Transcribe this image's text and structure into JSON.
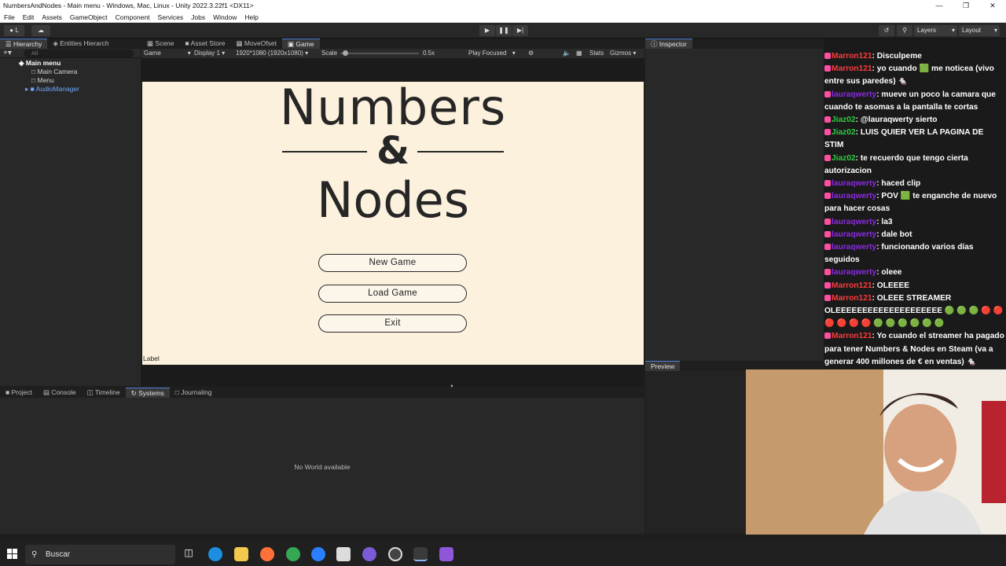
{
  "window": {
    "title": "NumbersAndNodes - Main menu - Windows, Mac, Linux - Unity 2022.3.22f1 <DX11>"
  },
  "menubar": [
    "File",
    "Edit",
    "Assets",
    "GameObject",
    "Component",
    "Services",
    "Jobs",
    "Window",
    "Help"
  ],
  "toolbar": {
    "account": "L",
    "layers": "Layers",
    "layout": "Layout"
  },
  "hierarchy": {
    "tabs": [
      "Hierarchy",
      "Entities Hierarch"
    ],
    "search_placeholder": "All",
    "items": [
      "Main menu",
      "Main Camera",
      "Menu",
      "AudioManager"
    ]
  },
  "game": {
    "tabs": [
      "Scene",
      "Asset Store",
      "MoveOfset",
      "Game"
    ],
    "display_mode": "Game",
    "display": "Display 1",
    "resolution": "1920*1080 (1920x1080)",
    "scale_label": "Scale",
    "scale_value": "0.5x",
    "play_mode": "Play Focused",
    "stats": "Stats",
    "gizmos": "Gizmos",
    "scale_fraction": 0.03
  },
  "menu_screen": {
    "title_line1": "Numbers",
    "title_amp": "&",
    "title_line2": "Nodes",
    "buttons": [
      "New Game",
      "Load Game",
      "Exit"
    ],
    "label": "Label"
  },
  "inspector": {
    "tab": "Inspector",
    "preview_tab": "Preview"
  },
  "bottom": {
    "tabs": [
      "Project",
      "Console",
      "Timeline",
      "Systems",
      "Journaling"
    ],
    "empty_message": "No World available"
  },
  "chat": [
    {
      "user": "Marron121",
      "color": "#ff3b3b",
      "text": "Disculpeme"
    },
    {
      "user": "Marron121",
      "color": "#ff3b3b",
      "text": "yo cuando 🟩 me noticea (vivo entre sus paredes) 🐁"
    },
    {
      "user": "lauraqwerty",
      "color": "#8a2be2",
      "text": "mueve un poco la camara que cuando te asomas a la pantalla te cortas"
    },
    {
      "user": "Jiaz02",
      "color": "#2ecc40",
      "text": "@lauraqwerty sierto"
    },
    {
      "user": "Jiaz02",
      "color": "#2ecc40",
      "text": "LUIS QUIER VER LA PAGINA DE STIM"
    },
    {
      "user": "Jiaz02",
      "color": "#2ecc40",
      "text": "te recuerdo que tengo cierta autorizacion"
    },
    {
      "user": "lauraqwerty",
      "color": "#8a2be2",
      "text": "haced clip"
    },
    {
      "user": "lauraqwerty",
      "color": "#8a2be2",
      "text": "POV 🟩 te enganche de nuevo para hacer cosas"
    },
    {
      "user": "lauraqwerty",
      "color": "#8a2be2",
      "text": "la3"
    },
    {
      "user": "lauraqwerty",
      "color": "#8a2be2",
      "text": "dale bot"
    },
    {
      "user": "lauraqwerty",
      "color": "#8a2be2",
      "text": "funcionando varios días seguidos"
    },
    {
      "user": "lauraqwerty",
      "color": "#8a2be2",
      "text": "oleee"
    },
    {
      "user": "Marron121",
      "color": "#ff3b3b",
      "text": "OLEEEE"
    },
    {
      "user": "Marron121",
      "color": "#ff3b3b",
      "text": "OLEEE STREAMER OLEEEEEEEEEEEEEEEEEEEE 🟢 🟢 🟢 🔴 🔴 🔴 🔴 🔴 🔴 🟢 🟢 🟢 🟢 🟢 🟢"
    },
    {
      "user": "Marron121",
      "color": "#ff3b3b",
      "text": "Yo cuando el streamer ha pagado para tener Numbers & Nodes en Steam (va a generar 400 millones de € en ventas) 🐁"
    }
  ],
  "taskbar": {
    "search_placeholder": "Buscar"
  },
  "colors": {
    "canvas_bg": "#fcf1dc",
    "panel_bg": "#282828",
    "accent": "#4a7fd6"
  }
}
